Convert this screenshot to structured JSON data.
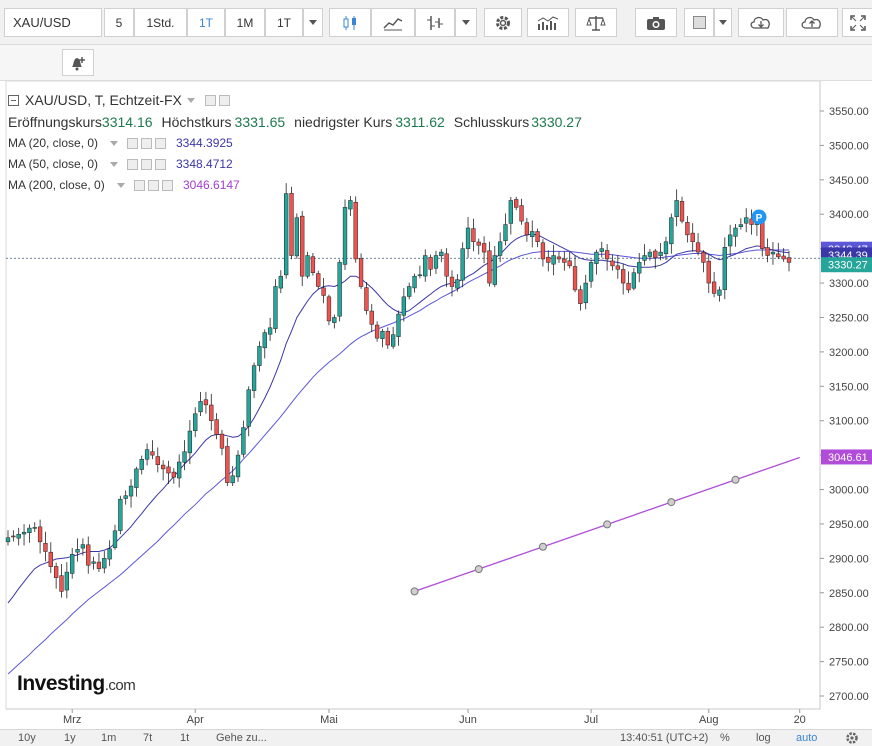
{
  "toolbar": {
    "symbol": "XAU/USD",
    "intervals": [
      "5",
      "1Std.",
      "1T",
      "1M",
      "1T"
    ],
    "active_interval_index": 2
  },
  "legend": {
    "title": "XAU/USD, T, Echtzeit-FX",
    "open_label": "Eröffnungskurs",
    "open_value": "3314.16",
    "high_label": "Höchstkurs",
    "high_value": "3331.65",
    "low_label": "niedrigster Kurs",
    "low_value": "3311.62",
    "close_label": "Schlusskurs",
    "close_value": "3330.27",
    "ma20_label": "MA (20, close, 0)",
    "ma20_value": "3344.3925",
    "ma50_label": "MA (50, close, 0)",
    "ma50_value": "3348.4712",
    "ma200_label": "MA (200, close, 0)",
    "ma200_value": "3046.6147"
  },
  "watermark": {
    "brand": "Investing",
    "suffix": ".com"
  },
  "bottom_bar": {
    "ranges": [
      "10y",
      "1y",
      "1m",
      "7t",
      "1t"
    ],
    "goto": "Gehe zu...",
    "time": "13:40:51 (UTC+2)",
    "percent": "%",
    "log": "log",
    "auto": "auto"
  },
  "colors": {
    "up": "#26a69a",
    "down": "#ef5350",
    "ma20": "#3a37a8",
    "ma50": "#5b57d6",
    "ma200": "#b04cd8",
    "axis_text": "#444444",
    "grid": "#eeeeee"
  },
  "chart_data": {
    "type": "candlestick",
    "y_axis": {
      "min": 2700,
      "max": 3550,
      "ticks": [
        2700,
        2750,
        2800,
        2850,
        2900,
        2950,
        3000,
        3050,
        3100,
        3150,
        3200,
        3250,
        3300,
        3350,
        3400,
        3450,
        3500,
        3550
      ],
      "tick_labels": [
        "2700.00",
        "2750.00",
        "2800.00",
        "2850.00",
        "2900.00",
        "2950.00",
        "3000.00",
        "3050.00",
        "3100.00",
        "3150.00",
        "3200.00",
        "3250.00",
        "3300.00",
        "3350.00",
        "3400.00",
        "3450.00",
        "3500.00",
        "3550.00"
      ]
    },
    "x_axis": {
      "labels": [
        "Mrz",
        "Apr",
        "Mai",
        "Jun",
        "Jul",
        "Aug",
        "20"
      ],
      "label_bar_index": [
        12,
        35,
        60,
        86,
        109,
        131,
        148
      ]
    },
    "price_tags": [
      {
        "value": 3348.47,
        "label": "3348.47",
        "color": "#5b57d6"
      },
      {
        "value": 3344.39,
        "label": "3344.39",
        "color": "#3a37a8"
      },
      {
        "value": 3330.27,
        "label": "3330.27",
        "color": "#26a69a"
      },
      {
        "value": 3046.61,
        "label": "3046.61",
        "color": "#b04cd8"
      }
    ],
    "current_price": 3336,
    "close": [
      2930,
      2932,
      2935,
      2938,
      2944,
      2945,
      2924,
      2910,
      2888,
      2872,
      2852,
      2880,
      2906,
      2913,
      2920,
      2890,
      2895,
      2885,
      2900,
      2914,
      2940,
      2986,
      2991,
      3005,
      3030,
      3044,
      3058,
      3050,
      3036,
      3030,
      3024,
      3018,
      3040,
      3055,
      3085,
      3110,
      3128,
      3123,
      3100,
      3080,
      3060,
      3010,
      3020,
      3050,
      3090,
      3145,
      3180,
      3208,
      3228,
      3235,
      3295,
      3310,
      3430,
      3340,
      3395,
      3310,
      3340,
      3315,
      3295,
      3282,
      3245,
      3250,
      3330,
      3410,
      3420,
      3335,
      3295,
      3260,
      3240,
      3220,
      3230,
      3210,
      3225,
      3255,
      3280,
      3295,
      3310,
      3312,
      3340,
      3320,
      3340,
      3345,
      3310,
      3295,
      3305,
      3350,
      3380,
      3360,
      3355,
      3345,
      3300,
      3340,
      3360,
      3385,
      3420,
      3410,
      3390,
      3370,
      3375,
      3360,
      3335,
      3330,
      3340,
      3335,
      3330,
      3325,
      3290,
      3270,
      3300,
      3330,
      3345,
      3350,
      3335,
      3325,
      3320,
      3300,
      3290,
      3315,
      3330,
      3340,
      3345,
      3337,
      3345,
      3360,
      3395,
      3420,
      3390,
      3370,
      3360,
      3345,
      3330,
      3300,
      3285,
      3290,
      3352,
      3370,
      3380,
      3385,
      3395,
      3385,
      3388,
      3350,
      3340,
      3345,
      3338,
      3335,
      3330
    ],
    "ma20": [
      2835,
      2845,
      2856,
      2866,
      2876,
      2885,
      2890,
      2893,
      2896,
      2899,
      2900,
      2901,
      2903,
      2905,
      2908,
      2910,
      2910,
      2910,
      2912,
      2915,
      2922,
      2930,
      2938,
      2946,
      2956,
      2965,
      2975,
      2984,
      2993,
      3001,
      3010,
      3019,
      3028,
      3037,
      3045,
      3053,
      3063,
      3072,
      3078,
      3080,
      3080,
      3078,
      3076,
      3077,
      3083,
      3092,
      3104,
      3118,
      3133,
      3149,
      3168,
      3188,
      3212,
      3230,
      3250,
      3262,
      3274,
      3284,
      3291,
      3295,
      3296,
      3295,
      3298,
      3303,
      3310,
      3310,
      3306,
      3300,
      3293,
      3285,
      3276,
      3268,
      3262,
      3258,
      3257,
      3260,
      3266,
      3272,
      3278,
      3284,
      3290,
      3295,
      3298,
      3300,
      3302,
      3305,
      3310,
      3314,
      3320,
      3326,
      3330,
      3336,
      3342,
      3350,
      3358,
      3364,
      3368,
      3370,
      3371,
      3370,
      3366,
      3362,
      3358,
      3354,
      3350,
      3346,
      3340,
      3336,
      3334,
      3333,
      3333,
      3333,
      3332,
      3331,
      3330,
      3328,
      3325,
      3324,
      3323,
      3323,
      3323,
      3324,
      3326,
      3330,
      3336,
      3342,
      3344,
      3346,
      3347,
      3347,
      3346,
      3342,
      3337,
      3334,
      3336,
      3339,
      3342,
      3346,
      3350,
      3352,
      3354,
      3353,
      3350,
      3348,
      3346,
      3345,
      3344
    ],
    "ma50": [
      2732,
      2739,
      2746,
      2753,
      2760,
      2768,
      2775,
      2782,
      2790,
      2797,
      2804,
      2811,
      2819,
      2826,
      2833,
      2840,
      2846,
      2852,
      2858,
      2864,
      2870,
      2876,
      2883,
      2890,
      2897,
      2904,
      2911,
      2918,
      2925,
      2933,
      2941,
      2948,
      2956,
      2964,
      2971,
      2978,
      2986,
      2994,
      3000,
      3007,
      3014,
      3020,
      3027,
      3035,
      3044,
      3052,
      3061,
      3070,
      3079,
      3088,
      3097,
      3106,
      3116,
      3126,
      3136,
      3145,
      3154,
      3163,
      3171,
      3178,
      3185,
      3191,
      3197,
      3204,
      3211,
      3217,
      3222,
      3226,
      3230,
      3233,
      3236,
      3239,
      3242,
      3245,
      3248,
      3252,
      3256,
      3260,
      3265,
      3270,
      3274,
      3279,
      3283,
      3287,
      3291,
      3296,
      3301,
      3305,
      3309,
      3313,
      3317,
      3321,
      3325,
      3330,
      3334,
      3337,
      3340,
      3342,
      3344,
      3345,
      3346,
      3346,
      3346,
      3346,
      3346,
      3346,
      3345,
      3344,
      3343,
      3342,
      3342,
      3342,
      3342,
      3341,
      3340,
      3339,
      3338,
      3337,
      3336,
      3336,
      3336,
      3336,
      3337,
      3338,
      3339,
      3340,
      3341,
      3342,
      3343,
      3343,
      3343,
      3342,
      3341,
      3340,
      3341,
      3342,
      3343,
      3344,
      3346,
      3347,
      3348,
      3348,
      3348,
      3348,
      3348,
      3348,
      3348
    ],
    "ma200": {
      "start_index": 76,
      "start_value": 2852,
      "end_index": 148,
      "end_value": 3046.61,
      "marker_indices": [
        76,
        88,
        100,
        112,
        124,
        136
      ]
    }
  }
}
